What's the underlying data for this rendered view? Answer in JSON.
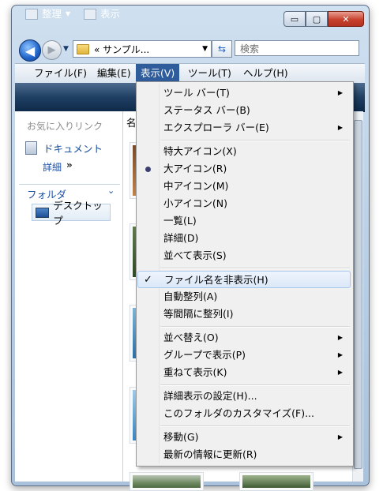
{
  "titlebar": {
    "min": "▭",
    "max": "▢",
    "close": "✕"
  },
  "address": {
    "back_glyph": "◀",
    "forward_glyph": "▶",
    "breadcrumb": "« サンプル...",
    "dropdown_glyph": "▼",
    "refresh_glyph": "⇆",
    "search_placeholder": "検索"
  },
  "menubar": [
    "ファイル(F)",
    "編集(E)",
    "表示(V)",
    "ツール(T)",
    "ヘルプ(H)"
  ],
  "commandbar": {
    "organize": "整理",
    "views": "表示"
  },
  "navpane": {
    "favorites_header": "お気に入りリンク",
    "documents": "ドキュメント",
    "more": "詳細",
    "more_glyph": "»",
    "folders": "フォルダ",
    "folders_chevron": "⌄",
    "desktop": "デスクトップ"
  },
  "content": {
    "column_header": "名"
  },
  "view_menu": {
    "group1": [
      {
        "label": "ツール バー(T)",
        "submenu": true
      },
      {
        "label": "ステータス バー(B)",
        "submenu": false
      },
      {
        "label": "エクスプローラ バー(E)",
        "submenu": true
      }
    ],
    "group2": [
      {
        "label": "特大アイコン(X)"
      },
      {
        "label": "大アイコン(R)",
        "selected": true
      },
      {
        "label": "中アイコン(M)"
      },
      {
        "label": "小アイコン(N)"
      },
      {
        "label": "一覧(L)"
      },
      {
        "label": "詳細(D)"
      },
      {
        "label": "並べて表示(S)"
      }
    ],
    "group3": [
      {
        "label": "ファイル名を非表示(H)",
        "checked": true,
        "highlighted": true
      },
      {
        "label": "自動整列(A)"
      },
      {
        "label": "等間隔に整列(I)"
      }
    ],
    "group4": [
      {
        "label": "並べ替え(O)",
        "submenu": true
      },
      {
        "label": "グループで表示(P)",
        "submenu": true
      },
      {
        "label": "重ねて表示(K)",
        "submenu": true
      }
    ],
    "group5": [
      {
        "label": "詳細表示の設定(H)..."
      },
      {
        "label": "このフォルダのカスタマイズ(F)..."
      }
    ],
    "group6": [
      {
        "label": "移動(G)",
        "submenu": true
      },
      {
        "label": "最新の情報に更新(R)"
      }
    ],
    "check_glyph": "✓",
    "submenu_glyph": "▶"
  }
}
